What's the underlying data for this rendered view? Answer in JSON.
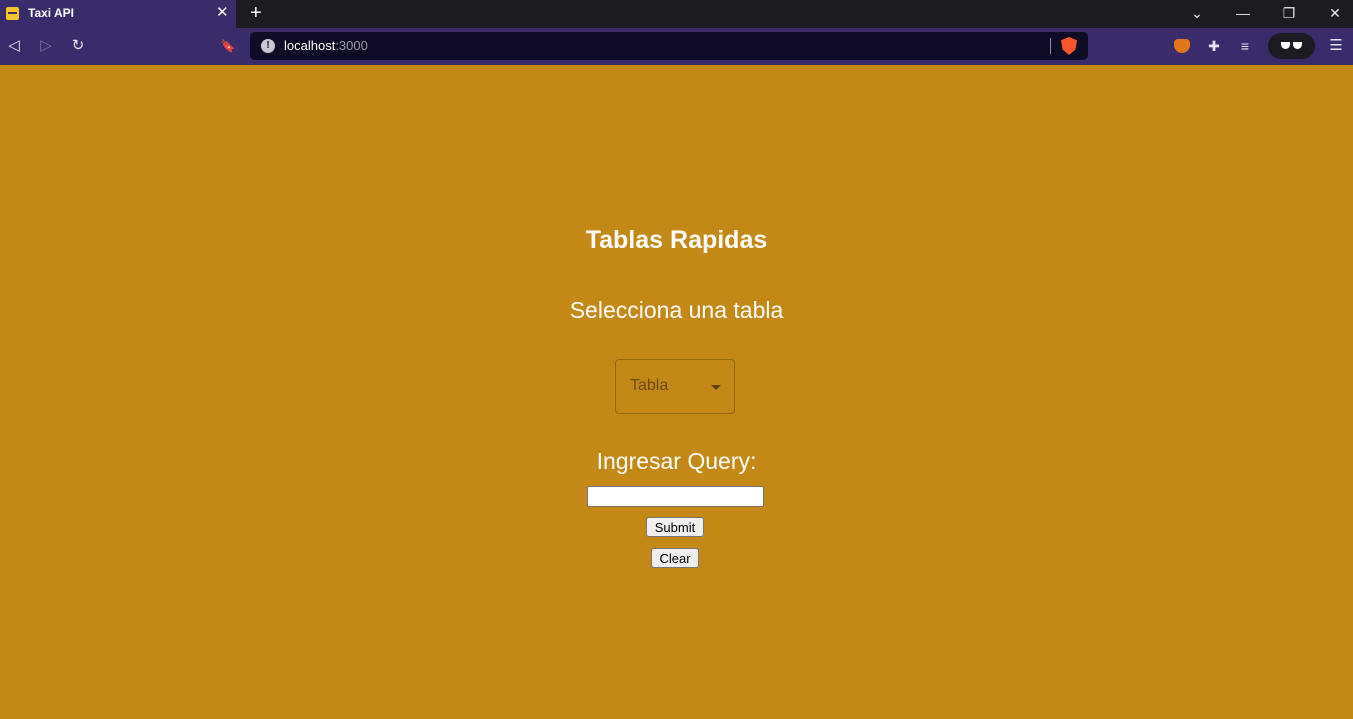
{
  "browser": {
    "tab": {
      "title": "Taxi API",
      "close_glyph": "✕"
    },
    "new_tab_glyph": "+",
    "window_controls": {
      "list_glyph": "⌄",
      "minimize_glyph": "—",
      "restore_glyph": "❐",
      "close_glyph": "✕"
    },
    "nav": {
      "back_glyph": "◁",
      "forward_glyph": "▷",
      "reload_glyph": "↻",
      "bookmark_glyph": "🔖",
      "menu_glyph": "☰"
    },
    "url": {
      "host": "localhost",
      "port": ":3000",
      "info_glyph": "!"
    },
    "extensions": {
      "puzzle_glyph": "✚",
      "playlist_glyph": "≡"
    },
    "colors": {
      "tabbar": "#1c1b22",
      "toolbar": "#3a2c6b",
      "urlbar": "#0e0b24"
    }
  },
  "page": {
    "title": "Tablas Rapidas",
    "select_label": "Selecciona una tabla",
    "select": {
      "placeholder": "Tabla"
    },
    "query_label": "Ingresar Query:",
    "query_input": {
      "value": ""
    },
    "submit_label": "Submit",
    "clear_label": "Clear",
    "background": "#c38815"
  }
}
